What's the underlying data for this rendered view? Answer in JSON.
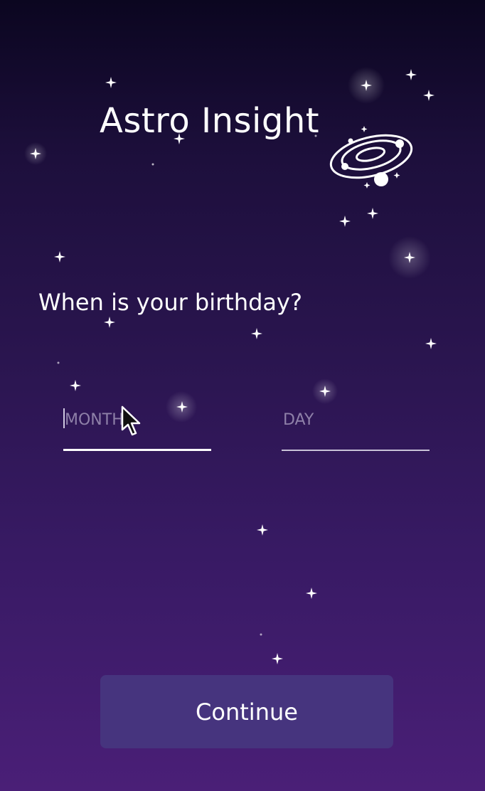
{
  "app": {
    "title": "Astro Insight",
    "logo_icon": "orbit-planets-icon"
  },
  "prompt": {
    "question": "When is your birthday?"
  },
  "form": {
    "month": {
      "placeholder": "MONTH",
      "value": ""
    },
    "day": {
      "placeholder": "DAY",
      "value": ""
    }
  },
  "actions": {
    "continue_label": "Continue"
  },
  "theme": {
    "background_top": "#0b0620",
    "background_bottom": "#4a1f77",
    "button_color": "#46347e",
    "text_color": "#ffffff",
    "placeholder_color": "#8e80a8"
  }
}
